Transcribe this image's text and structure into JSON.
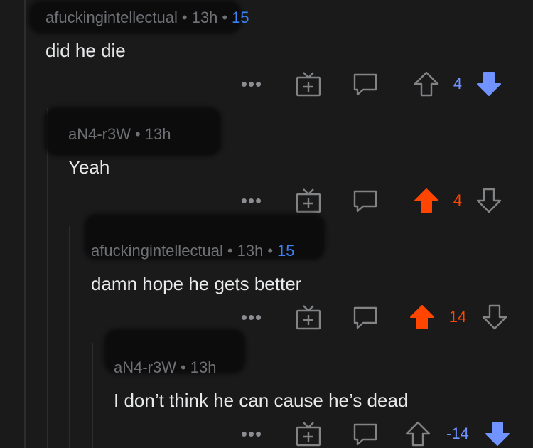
{
  "colors": {
    "background": "#1a1a1b",
    "upvote_active": "#ff4500",
    "downvote_active": "#7193ff",
    "award_count": "#3b82f6",
    "icon_default": "#818384"
  },
  "icons": {
    "more": "more-dots-icon",
    "award": "gift-icon",
    "reply": "speech-bubble-icon",
    "upvote": "arrow-up-icon",
    "downvote": "arrow-down-icon"
  },
  "comments": [
    {
      "author": "afuckingintellectual",
      "time": "13h",
      "awards": "15",
      "text": "did he die",
      "score": "4",
      "vote": "down",
      "more_label": "•••"
    },
    {
      "author": "aN4-r3W",
      "time": "13h",
      "awards": "",
      "text": "Yeah",
      "score": "4",
      "vote": "up",
      "more_label": "•••"
    },
    {
      "author": "afuckingintellectual",
      "time": "13h",
      "awards": "15",
      "text": "damn hope he gets better",
      "score": "14",
      "vote": "up",
      "more_label": "•••"
    },
    {
      "author": "aN4-r3W",
      "time": "13h",
      "awards": "",
      "text": "I don’t think he can cause he’s dead",
      "score": "-14",
      "vote": "down",
      "more_label": "•••"
    }
  ]
}
